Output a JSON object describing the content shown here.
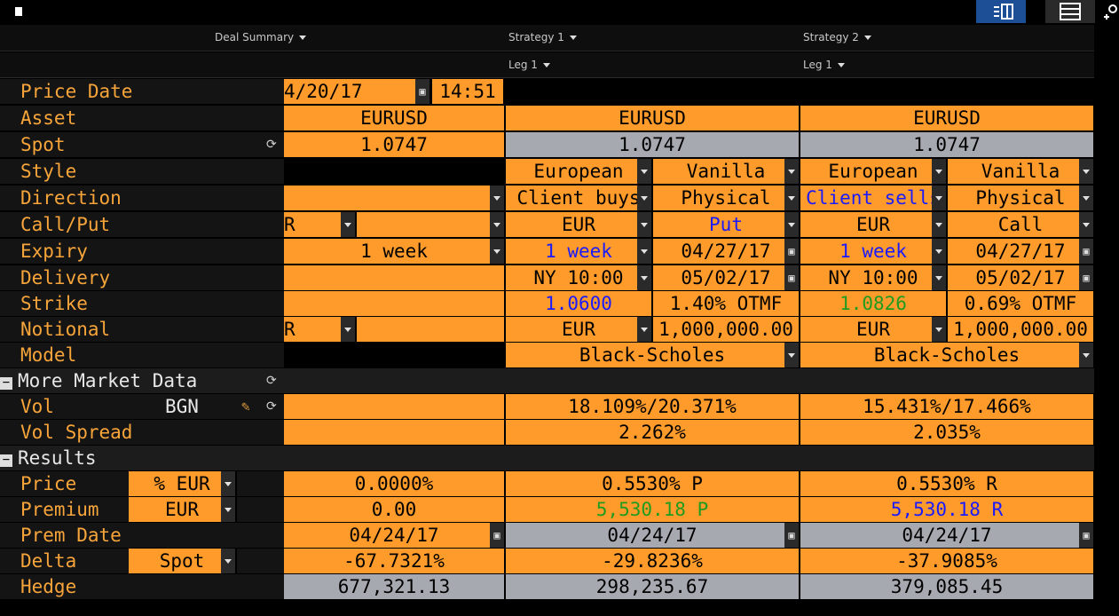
{
  "header": {
    "deal_summary": "Deal Summary",
    "strategy1": "Strategy 1",
    "strategy2": "Strategy 2",
    "leg1a": "Leg 1",
    "leg1b": "Leg 1"
  },
  "labels": {
    "price_date": "Price Date",
    "asset": "Asset",
    "spot": "Spot",
    "style": "Style",
    "direction": "Direction",
    "callput": "Call/Put",
    "expiry": "Expiry",
    "delivery": "Delivery",
    "strike": "Strike",
    "notional": "Notional",
    "model": "Model",
    "more_market_data": "More Market Data",
    "vol": "Vol",
    "vol_source": "BGN",
    "vol_spread": "Vol Spread",
    "results": "Results",
    "price": "Price",
    "premium": "Premium",
    "prem_date": "Prem Date",
    "delta": "Delta",
    "hedge": "Hedge"
  },
  "selectors": {
    "price_unit": "% EUR",
    "premium_ccy": "EUR",
    "delta_type": "Spot"
  },
  "deal": {
    "price_date": "4/20/17",
    "price_time": "14:51",
    "asset": "EURUSD",
    "spot": "1.0747",
    "callput": "R",
    "expiry": "1 week",
    "notional": "R",
    "price": "0.0000%",
    "premium": "0.00",
    "prem_date": "04/24/17",
    "delta": "-67.7321%",
    "hedge": "677,321.13"
  },
  "s1": {
    "asset": "EURUSD",
    "spot": "1.0747",
    "style": "European",
    "type": "Vanilla",
    "direction": "Client buys",
    "settle": "Physical",
    "ccy": "EUR",
    "callput": "Put",
    "expiry": "1 week",
    "expiry_date": "04/27/17",
    "cut": "NY 10:00",
    "delivery_date": "05/02/17",
    "strike": "1.0600",
    "moneyness": "1.40% OTMF",
    "notional_ccy": "EUR",
    "notional": "1,000,000.00",
    "model": "Black-Scholes",
    "vol": "18.109%/20.371%",
    "vol_spread": "2.262%",
    "price": "0.5530% P",
    "premium": "5,530.18 P",
    "prem_date": "04/24/17",
    "delta": "-29.8236%",
    "hedge": "298,235.67"
  },
  "s2": {
    "asset": "EURUSD",
    "spot": "1.0747",
    "style": "European",
    "type": "Vanilla",
    "direction": "Client sells",
    "settle": "Physical",
    "ccy": "EUR",
    "callput": "Call",
    "expiry": "1 week",
    "expiry_date": "04/27/17",
    "cut": "NY 10:00",
    "delivery_date": "05/02/17",
    "strike": "1.0826",
    "moneyness": "0.69% OTMF",
    "notional_ccy": "EUR",
    "notional": "1,000,000.00",
    "model": "Black-Scholes",
    "vol": "15.431%/17.466%",
    "vol_spread": "2.035%",
    "price": "0.5530% R",
    "premium": "5,530.18 R",
    "prem_date": "04/24/17",
    "delta": "-37.9085%",
    "hedge": "379,085.45"
  },
  "colors": {
    "orange": "#ff9b2b",
    "label": "#f7a53a",
    "blue": "#1a1aff",
    "green": "#1f9c1f",
    "gray": "#a6a9b0"
  },
  "icons": [
    "page-icon",
    "split-view-icon",
    "list-view-icon",
    "search-icon",
    "calendar-icon",
    "refresh-icon",
    "edit-icon",
    "dropdown-caret-icon",
    "collapse-icon"
  ]
}
